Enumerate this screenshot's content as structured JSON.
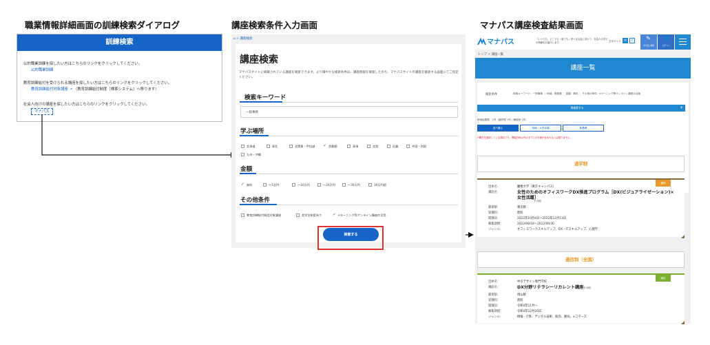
{
  "titles": {
    "p1": "職業情報詳細画面の訓練検索ダイアログ",
    "p2": "講座検索条件入力画面",
    "p3": "マナパス講座検査結果画面"
  },
  "dialog": {
    "header": "訓練検索",
    "line1": "公的職業訓練を探したい方はこちらのリンクをクリックしてください。",
    "link1": "公的職業訓練",
    "line2": "教育訓練給付を受けられる講座を探したい方はこちらのリンクをクリックしてください。",
    "link2": "教育訓練給付対象講座",
    "link2_suffix": "（教育訓練給付制度［検索システム］へ移ります）",
    "line3": "社会人向けの講座を探したい方はこちらのリンクをクリックしてください。",
    "link3": "マナパス"
  },
  "search": {
    "breadcrumb": "⌂ > 講座検索",
    "title": "講座検索",
    "desc": "マナパスサイトに掲載されている講座を検索できます。より細やかな検索条件は、講座情報を検索したのち、マナパスサイトの講座を検索する画面にてご指定ください。",
    "kw_heading": "検索キーワード",
    "kw_placeholder": "一般事務",
    "place_heading": "学ぶ場所",
    "places": [
      {
        "label": "北海道",
        "checked": false
      },
      {
        "label": "東北",
        "checked": false
      },
      {
        "label": "北関東・甲信越",
        "checked": false
      },
      {
        "label": "首都圏",
        "checked": true
      },
      {
        "label": "東海",
        "checked": false
      },
      {
        "label": "北陸",
        "checked": false
      },
      {
        "label": "近畿",
        "checked": false
      },
      {
        "label": "中国・四国",
        "checked": false
      },
      {
        "label": "九州・沖縄",
        "checked": false
      }
    ],
    "price_heading": "金額",
    "prices": [
      {
        "label": "無料",
        "checked": true
      },
      {
        "label": "～5万円",
        "checked": false
      },
      {
        "label": "～10万円",
        "checked": false
      },
      {
        "label": "～20万円",
        "checked": false
      },
      {
        "label": "～30万円",
        "checked": false
      },
      {
        "label": "30万円超",
        "checked": false
      }
    ],
    "other_heading": "その他条件",
    "others": [
      {
        "label": "教育訓練給付制度対象講座",
        "checked": false
      },
      {
        "label": "奨学金制度有り",
        "checked": false
      },
      {
        "label": "eラーニング等オンライン講座の活用",
        "checked": true
      }
    ],
    "button": "検索する"
  },
  "results": {
    "logo": "マナパス",
    "tagline1": "「いつでも、どこでも・誰でも」学べる社会に向けて、社会人の学び",
    "tagline2": "の情報をお届けします",
    "login": "文字サイズ",
    "size_s": "中",
    "size_l": "大",
    "nav1": "学び直し情報",
    "nav2": "ログイン",
    "crumb": "トップ ＞ 講座一覧",
    "heading": "講座一覧",
    "cond_label": "検索条件",
    "cond_value": "検索キーワード：一般事務 ｜ 地域：首都圏 ｜ 金額：無料 ｜ その他の条件：eラーニング等オンライン講座の活用",
    "research": "再検索する",
    "count": "検索結果数：2件（通学制 1件 / 通信制 1件）",
    "tabs": [
      "並べ替え",
      "地域・大学名順",
      "新着順"
    ],
    "note": "※曜日を選択している場合でも、開始日時以外のすべての日程が含まれるとは限りません。",
    "section1": "通学制",
    "badge1": "通学",
    "course1": {
      "rows": [
        {
          "k": "団体名：",
          "v": "慶應大学（東京キャンパス）"
        },
        {
          "k": "講座名：",
          "v": "女性のためのオフィスワークDX推進プログラム［DX(ビジュアライゼーション)×女性活躍］"
        },
        {
          "k": "最寄駅：",
          "v": "東京駅"
        },
        {
          "k": "受講料：",
          "v": "無料"
        },
        {
          "k": "開講日：",
          "v": "2022年10月4日～2022年12月13日"
        },
        {
          "k": "募集期間：",
          "v": "2022/08/18～2022/09/30"
        },
        {
          "k": "ジャンル：",
          "v": "オフィスワークスキルアップ、DX・ITスキルアップ、心理学"
        }
      ],
      "extra": "その他"
    },
    "section2": "通信制（全国）",
    "badge2": "通信",
    "course2": {
      "rows": [
        {
          "k": "団体名：",
          "v": "中京デザイン専門学校"
        },
        {
          "k": "講座名：",
          "v": "DX分野リテラシーリカレント講座"
        },
        {
          "k": "最寄駅：",
          "v": "岡山駅"
        },
        {
          "k": "受講料：",
          "v": "無料"
        },
        {
          "k": "開講日：",
          "v": "令和4年11月～"
        },
        {
          "k": "募集期間：",
          "v": "令和4年12月20日"
        },
        {
          "k": "ジャンル：",
          "v": "情報・IT系、デジタル技術、販売、観光、eコマース"
        }
      ],
      "extra": "その他"
    }
  },
  "colors": {
    "brand_blue": "#1565c8",
    "header_blue": "#1f88d0",
    "red_frame": "#e03030",
    "orange": "#e89a2c",
    "green": "#7ab02c"
  }
}
